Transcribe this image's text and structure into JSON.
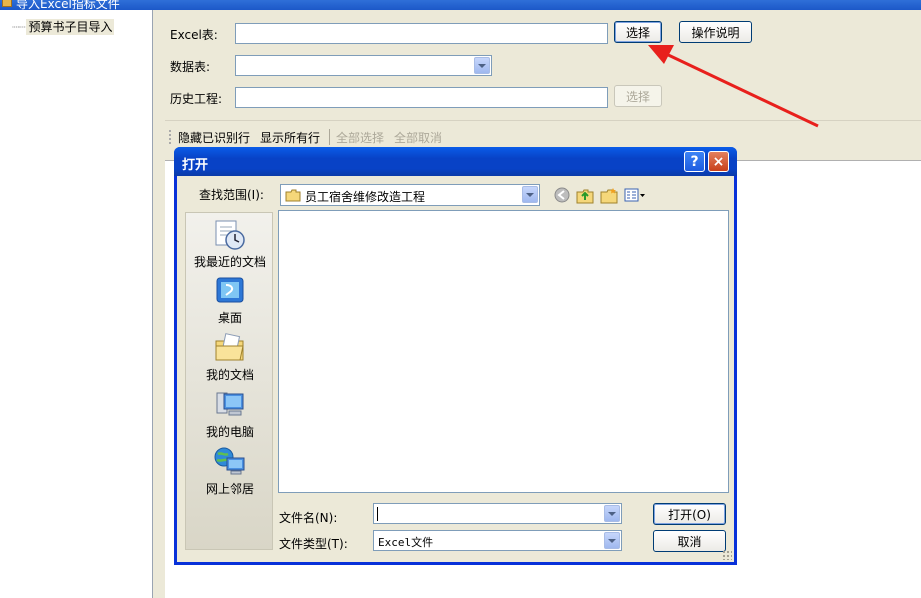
{
  "window": {
    "title": "导入Excel指标文件"
  },
  "tree": {
    "items": [
      {
        "label": "预算书子目导入"
      }
    ]
  },
  "form": {
    "excel_label": "Excel表:",
    "excel_value": "",
    "choose_button": "选择",
    "help_button": "操作说明",
    "datasheet_label": "数据表:",
    "datasheet_value": "",
    "history_label": "历史工程:",
    "history_value": "",
    "history_choose_button": "选择"
  },
  "toolbar": {
    "hide_identified": "隐藏已识别行",
    "show_all": "显示所有行",
    "select_all": "全部选择",
    "deselect_all": "全部取消"
  },
  "dialog": {
    "title": "打开",
    "help_glyph": "?",
    "close_glyph": "×",
    "look_in_label": "查找范围(I):",
    "look_in_value": "员工宿舍维修改造工程",
    "places": [
      {
        "label": "我最近的文档",
        "icon": "recent-documents-icon"
      },
      {
        "label": "桌面",
        "icon": "desktop-icon"
      },
      {
        "label": "我的文档",
        "icon": "my-documents-icon"
      },
      {
        "label": "我的电脑",
        "icon": "my-computer-icon"
      },
      {
        "label": "网上邻居",
        "icon": "network-places-icon"
      }
    ],
    "filename_label": "文件名(N):",
    "filename_value": "",
    "filetype_label": "文件类型(T):",
    "filetype_value": "Excel文件",
    "open_button": "打开(O)",
    "cancel_button": "取消"
  },
  "colors": {
    "xp_blue": "#0842c6",
    "annotation_arrow": "#e8201c"
  }
}
